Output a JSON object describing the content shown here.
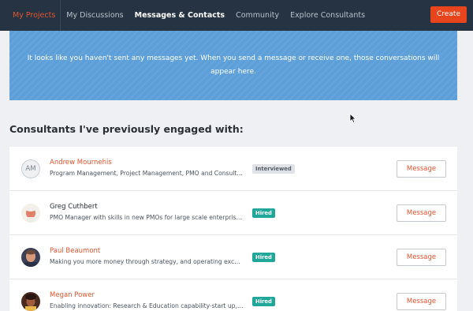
{
  "nav": {
    "items": [
      "My Projects",
      "My Discussions",
      "Messages & Contacts",
      "Community",
      "Explore Consultants"
    ],
    "create_label": "Create"
  },
  "banner": {
    "text": "It looks like you haven't sent any messages yet. When you send a message or receive one, those conversations will appear here."
  },
  "section_title": "Consultants I've previously engaged with:",
  "consultants": [
    {
      "initials": "AM",
      "name": "Andrew Mournehis",
      "description": "Program Management, Project Management, PMO and Consulting",
      "status": "Interviewed",
      "action": "Message"
    },
    {
      "initials": "",
      "name": "Greg Cuthbert",
      "description": "PMO Manager with skills in new PMOs for large scale enterprise ...",
      "status": "Hired",
      "action": "Message"
    },
    {
      "initials": "",
      "name": "Paul Beaumont",
      "description": "Making you more money through strategy, and operating excelle...",
      "status": "Hired",
      "action": "Message"
    },
    {
      "initials": "",
      "name": "Megan Power",
      "description": "Enabling innovation: Research & Education capability-start up, se...",
      "status": "Hired",
      "action": "Message"
    }
  ],
  "colors": {
    "nav_bg": "#263342",
    "accent": "#e0552f",
    "create_bg": "#e8451c",
    "banner_bg": "#5c9fd9",
    "hired": "#1fa89a",
    "interviewed": "#dfe2e6"
  }
}
